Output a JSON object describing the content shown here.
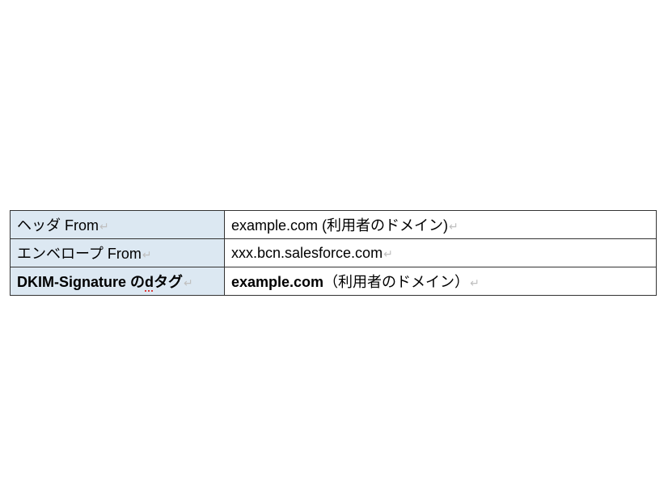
{
  "table": {
    "rows": [
      {
        "label": "ヘッダ From",
        "value_main": "example.com",
        "value_extra": " (利用者のドメイン)",
        "label_bold": false,
        "value_bold": false,
        "label_underline_part": ""
      },
      {
        "label": "エンベロープ From",
        "value_main": "xxx.bcn.salesforce.com",
        "value_extra": "",
        "label_bold": false,
        "value_bold": false,
        "label_underline_part": ""
      },
      {
        "label_prefix": "DKIM-Signature の",
        "label_underlined": "d",
        "label_suffix": "タグ",
        "value_main": "example.com",
        "value_extra": "（利用者のドメイン）",
        "label_bold": true,
        "value_bold": true
      }
    ]
  },
  "return_symbol": "↵"
}
